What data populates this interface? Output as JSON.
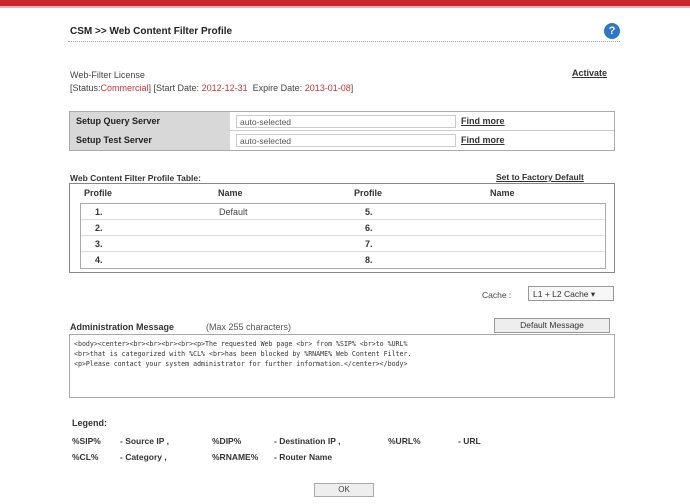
{
  "header": {
    "title": "CSM >> Web Content Filter Profile",
    "help_icon": "?"
  },
  "license": {
    "label": "Web-Filter License",
    "status_prefix": "[Status:",
    "status_value": "Commercial",
    "start_prefix": "] [Start Date:",
    "start_date": "2012-12-31",
    "expire_prefix": "Expire Date:",
    "expire_date": "2013-01-08",
    "suffix": "]",
    "activate": "Activate"
  },
  "servers": [
    {
      "label": "Setup Query Server",
      "value": "auto-selected",
      "link": "Find more"
    },
    {
      "label": "Setup Test Server",
      "value": "auto-selected",
      "link": "Find more"
    }
  ],
  "profile_table": {
    "label": "Web Content Filter Profile Table:",
    "factory": "Set to Factory Default",
    "headers": [
      "Profile",
      "Name",
      "Profile",
      "Name"
    ],
    "rows": [
      {
        "p1": "1.",
        "n1": "Default",
        "p2": "5.",
        "n2": ""
      },
      {
        "p1": "2.",
        "n1": "",
        "p2": "6.",
        "n2": ""
      },
      {
        "p1": "3.",
        "n1": "",
        "p2": "7.",
        "n2": ""
      },
      {
        "p1": "4.",
        "n1": "",
        "p2": "8.",
        "n2": ""
      }
    ]
  },
  "cache": {
    "label": "Cache :",
    "value": "L1 + L2 Cache ▾"
  },
  "admin": {
    "label": "Administration Message",
    "hint": "(Max 255 characters)",
    "default_button": "Default Message",
    "message": "<body><center><br><br><br><br><p>The requested Web page <br> from %SIP% <br>to %URL%\n<br>that is categorized with %CL% <br>has been blocked by %RNAME% Web Content Filter.\n<p>Please contact your system administrator for further information.</center></body>"
  },
  "legend": {
    "title": "Legend:",
    "items": [
      {
        "key": "%SIP%",
        "desc": "- Source IP ,"
      },
      {
        "key": "%DIP%",
        "desc": "- Destination IP ,"
      },
      {
        "key": "%URL%",
        "desc": "- URL"
      },
      {
        "key": "%CL%",
        "desc": "- Category ,"
      },
      {
        "key": "%RNAME%",
        "desc": "- Router Name"
      }
    ]
  },
  "ok": "OK"
}
